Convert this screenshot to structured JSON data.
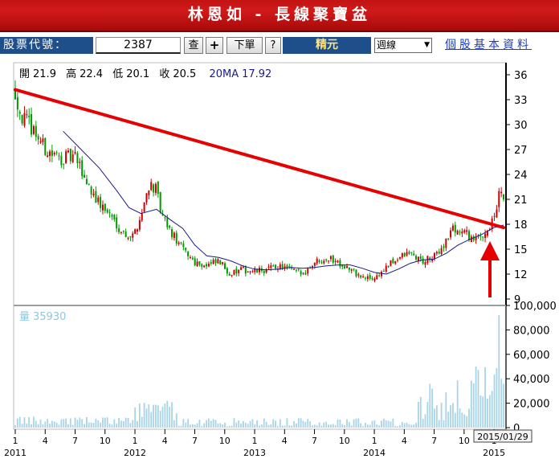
{
  "header": {
    "title": "林恩如 - 長線聚寶盆"
  },
  "toolbar": {
    "stock_code_label": "股票代號：",
    "stock_code_value": "2387",
    "query_button": "查",
    "add_button": "+",
    "order_button": "下單",
    "help_button": "?",
    "stock_name": "精元",
    "period_selected": "週線",
    "basic_info_link": "個股基本資料"
  },
  "colors": {
    "up": "#cc0000",
    "down": "#009900",
    "ma": "#1a1a8c",
    "trendline": "#e60000",
    "arrow": "#e60000",
    "volume": "#a8d4e8",
    "banner": "#c21313",
    "toolbar_bg": "#1e4f8a"
  },
  "chart_data": [
    {
      "type": "candlestick",
      "info": {
        "open_label": "開",
        "open": "21.9",
        "high_label": "高",
        "high": "22.4",
        "low_label": "低",
        "low": "20.1",
        "close_label": "收",
        "close": "20.5",
        "ma_label": "20MA",
        "ma": "17.92"
      },
      "price_ticks": [
        "36",
        "33",
        "30",
        "27",
        "24",
        "21",
        "18",
        "15",
        "12",
        "9"
      ],
      "ylim": [
        9,
        36.5
      ],
      "x_labels": [
        {
          "t": 0.0,
          "label": "1",
          "year": "2011"
        },
        {
          "t": 0.25,
          "label": "4"
        },
        {
          "t": 0.5,
          "label": "7"
        },
        {
          "t": 0.75,
          "label": "10"
        },
        {
          "t": 1.0,
          "label": "1",
          "year": "2012"
        },
        {
          "t": 1.25,
          "label": "4"
        },
        {
          "t": 1.5,
          "label": "7"
        },
        {
          "t": 1.75,
          "label": "10"
        },
        {
          "t": 2.0,
          "label": "1",
          "year": "2013"
        },
        {
          "t": 2.25,
          "label": "4"
        },
        {
          "t": 2.5,
          "label": "7"
        },
        {
          "t": 2.75,
          "label": "10"
        },
        {
          "t": 3.0,
          "label": "1",
          "year": "2014"
        },
        {
          "t": 3.25,
          "label": "4"
        },
        {
          "t": 3.5,
          "label": "7"
        },
        {
          "t": 3.75,
          "label": "10"
        },
        {
          "t": 4.0,
          "label": "1",
          "year": "2015"
        }
      ],
      "last_date": "2015/01/29",
      "close_path": [
        [
          0.0,
          34
        ],
        [
          0.05,
          31
        ],
        [
          0.15,
          29.5
        ],
        [
          0.25,
          27
        ],
        [
          0.35,
          26
        ],
        [
          0.5,
          26
        ],
        [
          0.6,
          23
        ],
        [
          0.7,
          20.5
        ],
        [
          0.8,
          19
        ],
        [
          0.9,
          17
        ],
        [
          0.98,
          16.5
        ],
        [
          1.05,
          19
        ],
        [
          1.12,
          23
        ],
        [
          1.18,
          22
        ],
        [
          1.22,
          19
        ],
        [
          1.3,
          17
        ],
        [
          1.4,
          15
        ],
        [
          1.5,
          13.5
        ],
        [
          1.6,
          13
        ],
        [
          1.7,
          13.5
        ],
        [
          1.8,
          12
        ],
        [
          1.9,
          12.5
        ],
        [
          2.0,
          12.3
        ],
        [
          2.1,
          12.5
        ],
        [
          2.2,
          13
        ],
        [
          2.3,
          12.5
        ],
        [
          2.4,
          12
        ],
        [
          2.5,
          13.5
        ],
        [
          2.6,
          14
        ],
        [
          2.7,
          13.5
        ],
        [
          2.8,
          12.5
        ],
        [
          2.9,
          11.5
        ],
        [
          3.0,
          11.5
        ],
        [
          3.08,
          12.5
        ],
        [
          3.2,
          14
        ],
        [
          3.3,
          14.5
        ],
        [
          3.4,
          13.5
        ],
        [
          3.5,
          14
        ],
        [
          3.6,
          16
        ],
        [
          3.65,
          17.5
        ],
        [
          3.75,
          17
        ],
        [
          3.85,
          16
        ],
        [
          3.92,
          17
        ],
        [
          4.0,
          18.5
        ],
        [
          4.05,
          22
        ],
        [
          4.1,
          20.5
        ]
      ],
      "ma_path": [
        [
          0.4,
          29.2
        ],
        [
          0.55,
          27
        ],
        [
          0.7,
          24.8
        ],
        [
          0.85,
          22
        ],
        [
          0.95,
          20
        ],
        [
          1.05,
          19.3
        ],
        [
          1.18,
          19.8
        ],
        [
          1.3,
          18.5
        ],
        [
          1.4,
          17.5
        ],
        [
          1.5,
          15.5
        ],
        [
          1.6,
          14.2
        ],
        [
          1.7,
          14
        ],
        [
          1.8,
          13.6
        ],
        [
          1.9,
          13
        ],
        [
          2.0,
          12.6
        ],
        [
          2.1,
          12.5
        ],
        [
          2.2,
          12.6
        ],
        [
          2.3,
          12.8
        ],
        [
          2.4,
          12.7
        ],
        [
          2.5,
          12.8
        ],
        [
          2.6,
          13
        ],
        [
          2.7,
          13.1
        ],
        [
          2.8,
          13.1
        ],
        [
          2.9,
          12.7
        ],
        [
          3.0,
          12.2
        ],
        [
          3.1,
          12
        ],
        [
          3.2,
          12.6
        ],
        [
          3.3,
          13.3
        ],
        [
          3.4,
          13.7
        ],
        [
          3.5,
          13.8
        ],
        [
          3.6,
          14.5
        ],
        [
          3.7,
          15.5
        ],
        [
          3.8,
          16.2
        ],
        [
          3.9,
          16.8
        ],
        [
          4.0,
          17.6
        ],
        [
          4.08,
          17.9
        ]
      ],
      "trendline": [
        [
          0.0,
          34.2
        ],
        [
          4.08,
          17.6
        ]
      ],
      "volume_label": "量",
      "volume": "35930",
      "volume_ticks": [
        "100,000",
        "80,000",
        "60,000",
        "40,000",
        "20,000",
        "0"
      ],
      "volume_ylim": [
        0,
        100000
      ]
    }
  ]
}
